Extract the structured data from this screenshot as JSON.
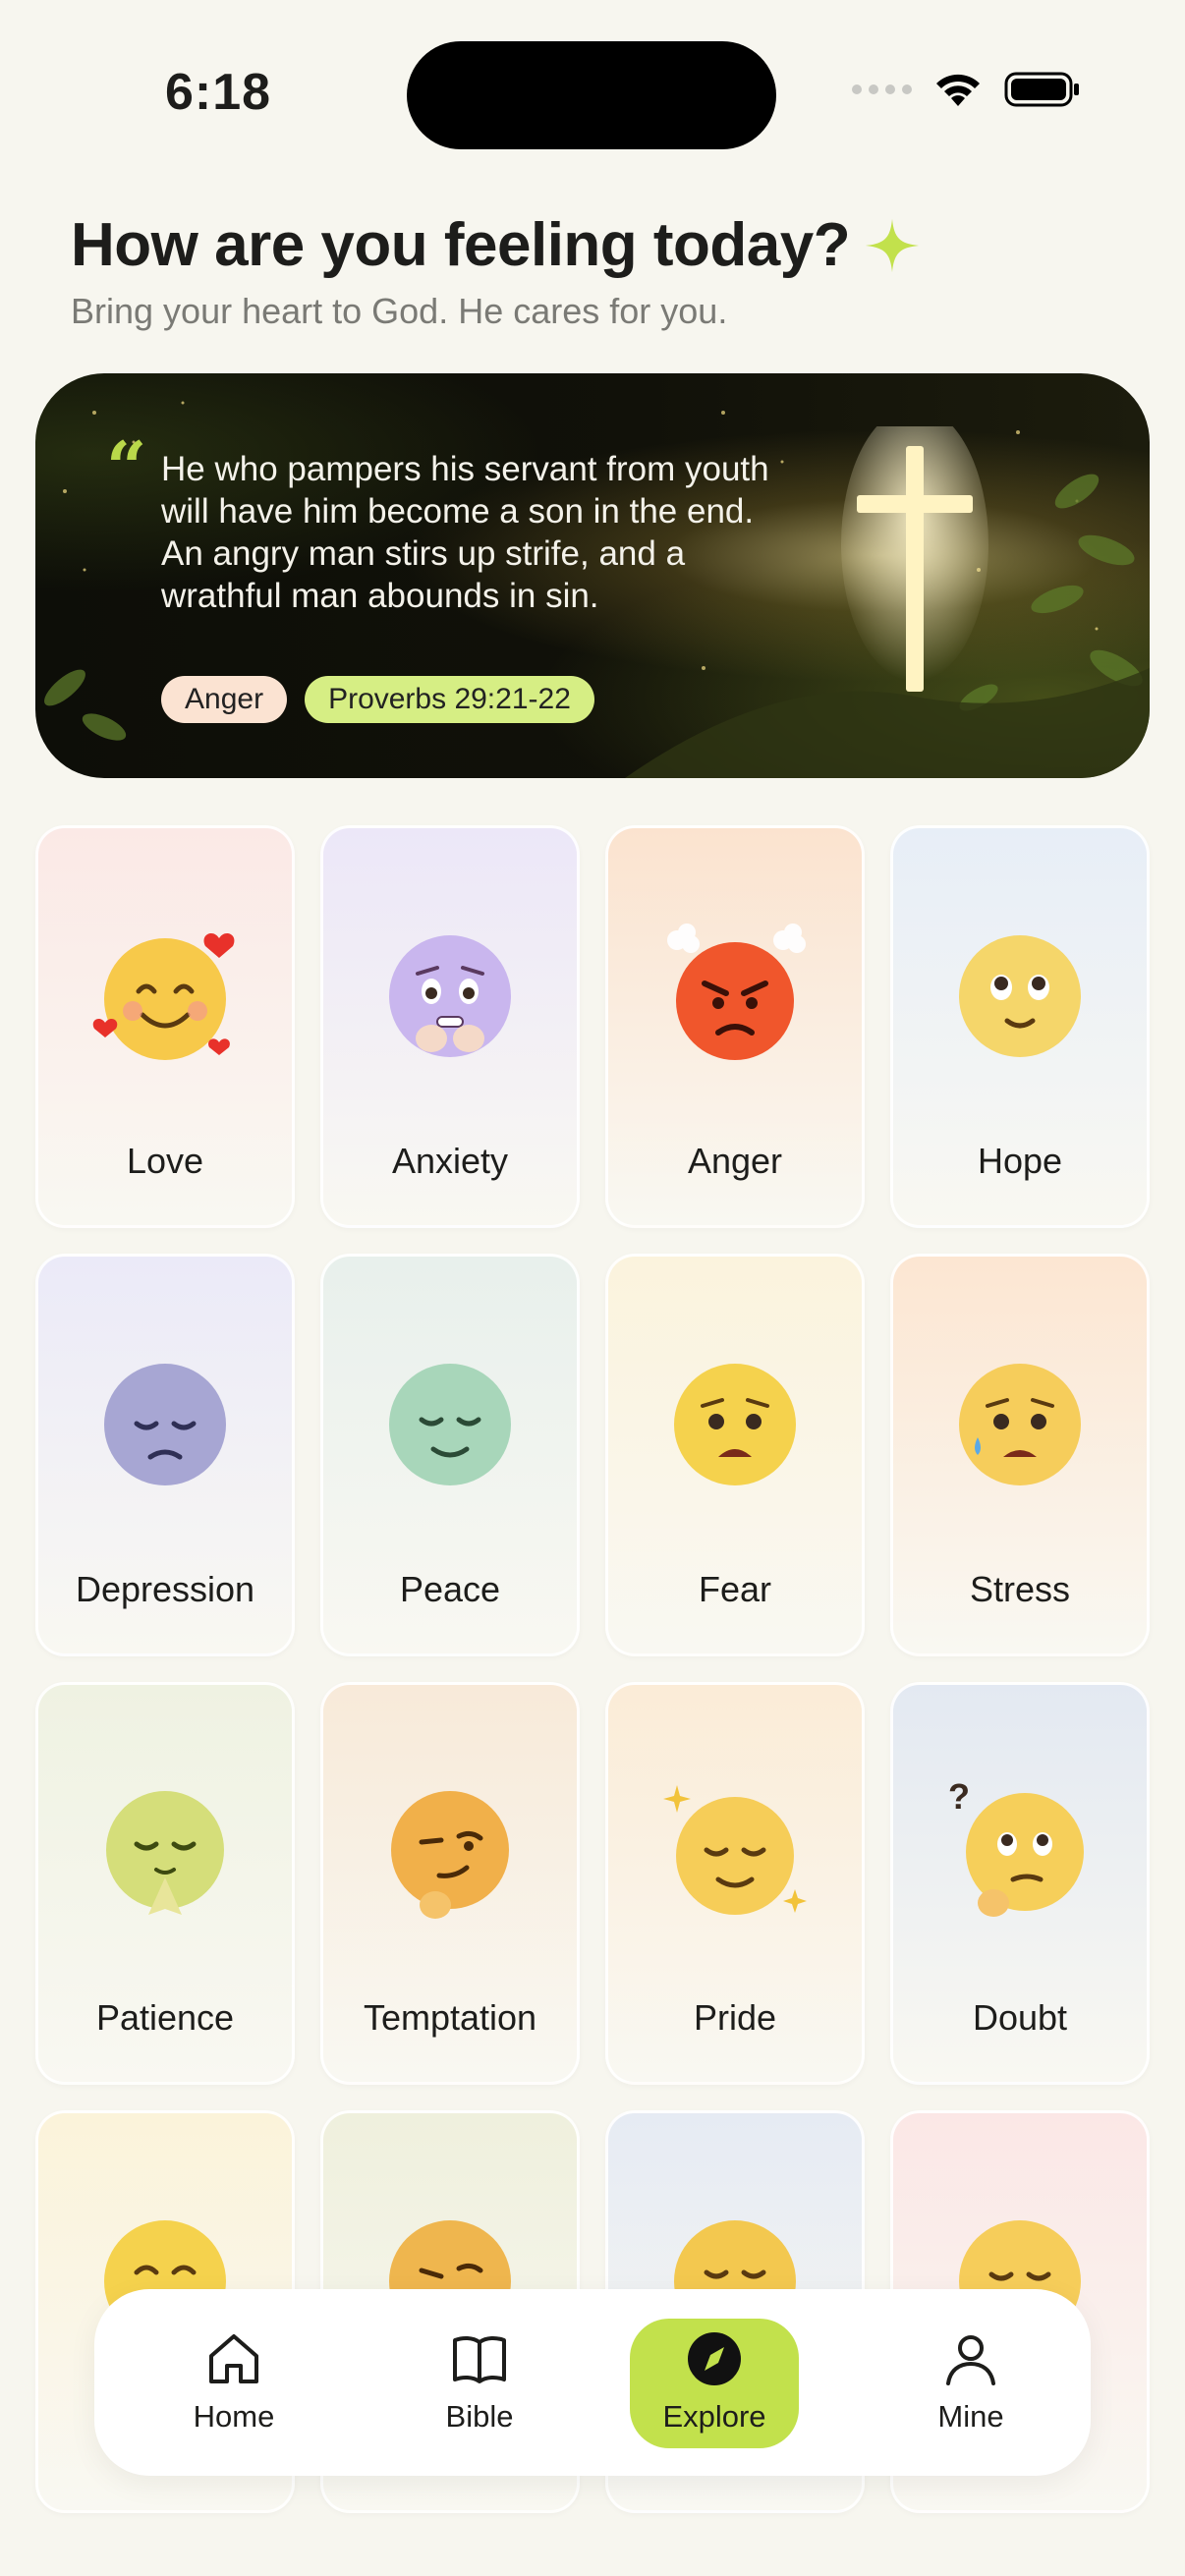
{
  "status_bar": {
    "time": "6:18"
  },
  "header": {
    "title": "How are you feeling today?",
    "subtitle": "Bring your heart to God. He cares for you."
  },
  "verse_card": {
    "quote_mark": "“",
    "text": "He who pampers his servant from youth will have him become a son in the end. An angry man stirs up strife, and a wrathful man abounds in sin.",
    "emotion_tag": "Anger",
    "reference": "Proverbs 29:21-22"
  },
  "emotions": [
    {
      "label": "Love",
      "bg": "#fbe9e6",
      "face": "#f7c94a",
      "icon": "smiling-face-with-hearts-icon"
    },
    {
      "label": "Anxiety",
      "bg": "#ece7f8",
      "face": "#c9b6ee",
      "icon": "anxious-face-icon"
    },
    {
      "label": "Anger",
      "bg": "#fbe3cf",
      "face": "#f0562c",
      "icon": "angry-face-icon"
    },
    {
      "label": "Hope",
      "bg": "#e7eef7",
      "face": "#f5d66a",
      "icon": "hopeful-face-icon"
    },
    {
      "label": "Depression",
      "bg": "#ebeaf8",
      "face": "#a7a6d3",
      "icon": "pensive-face-icon"
    },
    {
      "label": "Peace",
      "bg": "#e8f0ec",
      "face": "#a8d6ba",
      "icon": "relieved-face-icon"
    },
    {
      "label": "Fear",
      "bg": "#fbf3dd",
      "face": "#f5d24d",
      "icon": "fearful-face-icon"
    },
    {
      "label": "Stress",
      "bg": "#fce6d2",
      "face": "#f6cd5b",
      "icon": "crying-face-icon"
    },
    {
      "label": "Patience",
      "bg": "#eff2e2",
      "face": "#d5de7a",
      "icon": "praying-face-icon"
    },
    {
      "label": "Temptation",
      "bg": "#f8ead9",
      "face": "#f1b04a",
      "icon": "smirking-face-icon"
    },
    {
      "label": "Pride",
      "bg": "#fbecd7",
      "face": "#f6cd58",
      "icon": "proud-face-icon"
    },
    {
      "label": "Doubt",
      "bg": "#e3e9f2",
      "face": "#f6cf5a",
      "icon": "thinking-face-icon"
    },
    {
      "label": "",
      "bg": "#fbf3da",
      "face": "#f5d24d",
      "icon": "smiling-face-icon"
    },
    {
      "label": "",
      "bg": "#eff0dd",
      "face": "#efb64e",
      "icon": "squinting-face-icon"
    },
    {
      "label": "",
      "bg": "#e6ebf3",
      "face": "#f3c84f",
      "icon": "sad-face-icon"
    },
    {
      "label": "",
      "bg": "#fbe7e6",
      "face": "#f6cd5a",
      "icon": "content-face-icon"
    }
  ],
  "nav": {
    "items": [
      {
        "label": "Home",
        "icon": "home-icon"
      },
      {
        "label": "Bible",
        "icon": "book-icon"
      },
      {
        "label": "Explore",
        "icon": "compass-icon",
        "active": true
      },
      {
        "label": "Mine",
        "icon": "user-icon"
      }
    ]
  },
  "colors": {
    "accent": "#c2e14c",
    "background": "#f7f6ef",
    "tag_ref": "#d6ee84",
    "tag_emotion": "#fbe3d2"
  }
}
